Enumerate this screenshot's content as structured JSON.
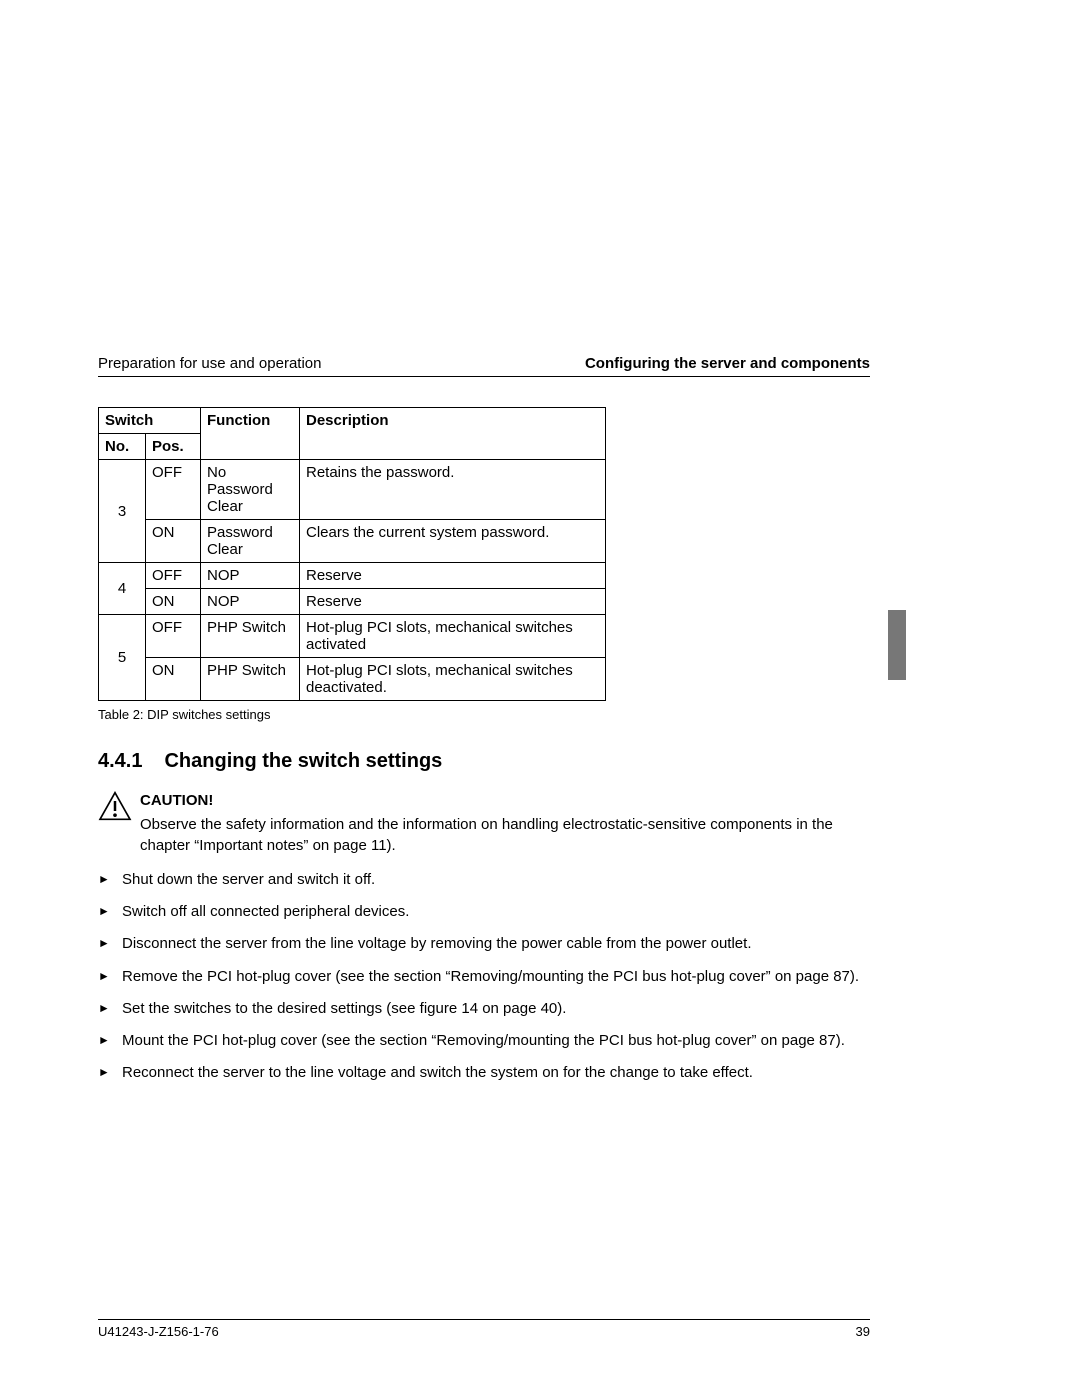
{
  "header": {
    "left": "Preparation for use and operation",
    "right": "Configuring the server and components"
  },
  "table": {
    "headers": {
      "switch": "Switch",
      "no": "No.",
      "pos": "Pos.",
      "function": "Function",
      "description": "Description"
    },
    "rows": [
      {
        "no": "3",
        "pos": "OFF",
        "function": "No Password Clear",
        "description": "Retains the password."
      },
      {
        "no": "",
        "pos": "ON",
        "function": "Password Clear",
        "description": "Clears the current system password."
      },
      {
        "no": "4",
        "pos": "OFF",
        "function": "NOP",
        "description": "Reserve"
      },
      {
        "no": "",
        "pos": "ON",
        "function": "NOP",
        "description": "Reserve"
      },
      {
        "no": "5",
        "pos": "OFF",
        "function": "PHP Switch",
        "description": "Hot-plug PCI slots, mechanical switches activated"
      },
      {
        "no": "",
        "pos": "ON",
        "function": "PHP Switch",
        "description": "Hot-plug PCI slots, mechanical switches deacti­vated."
      }
    ],
    "caption": "Table 2:  DIP switches settings"
  },
  "section": {
    "number": "4.4.1",
    "title": "Changing the switch settings"
  },
  "caution": {
    "title": "CAUTION!",
    "text": "Observe the safety information and the information on handling electro­static-sensitive components in the chapter “Important notes” on page 11)."
  },
  "steps": [
    "Shut down the server and switch it off.",
    "Switch off all connected peripheral devices.",
    "Disconnect the server from the line voltage by removing the power cable from the power outlet.",
    "Remove the PCI hot-plug cover (see the section “Removing/mounting the PCI bus hot-plug cover” on page 87).",
    "Set the switches to the desired settings (see figure 14 on page 40).",
    "Mount the PCI hot-plug cover (see the section “Removing/mounting the PCI bus hot-plug cover” on page 87).",
    "Reconnect the server to the line voltage and switch the system on for the change to take effect."
  ],
  "footer": {
    "doc_id": "U41243-J-Z156-1-76",
    "page": "39"
  }
}
